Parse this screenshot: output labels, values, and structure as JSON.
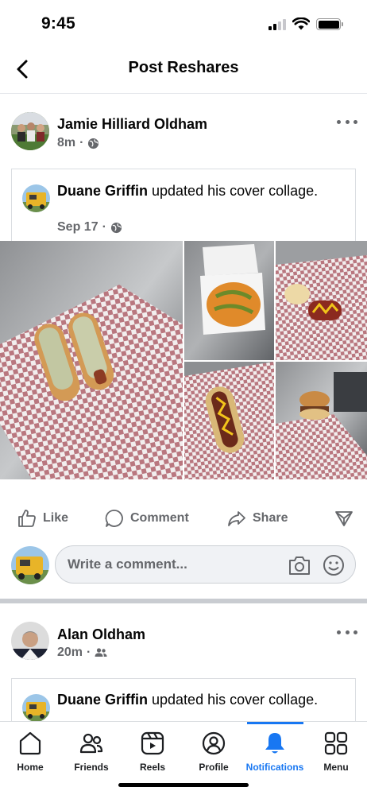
{
  "status_bar": {
    "time": "9:45",
    "battery_level": 1.0
  },
  "header": {
    "title": "Post Reshares"
  },
  "posts": [
    {
      "author": "Jamie Hilliard Oldham",
      "time": "8m",
      "audience_icon": "globe-icon",
      "shared": {
        "author": "Duane Griffin",
        "action": " updated his cover collage.",
        "date": "Sep 17",
        "audience_icon": "globe-icon"
      },
      "actions": {
        "like": "Like",
        "comment": "Comment",
        "share": "Share"
      },
      "comment_placeholder": "Write a comment..."
    },
    {
      "author": "Alan Oldham",
      "time": "20m",
      "audience_icon": "friends-icon",
      "shared": {
        "author": "Duane Griffin",
        "action": " updated his cover collage.",
        "date": "",
        "audience_icon": ""
      }
    }
  ],
  "tabs": [
    {
      "label": "Home",
      "icon": "home-icon"
    },
    {
      "label": "Friends",
      "icon": "friends-icon"
    },
    {
      "label": "Reels",
      "icon": "reels-icon"
    },
    {
      "label": "Profile",
      "icon": "profile-icon"
    },
    {
      "label": "Notifications",
      "icon": "bell-icon",
      "active": true
    },
    {
      "label": "Menu",
      "icon": "menu-grid-icon"
    }
  ],
  "colors": {
    "accent": "#1877f2",
    "secondary_text": "#65676b",
    "checker": "#b9777f"
  }
}
